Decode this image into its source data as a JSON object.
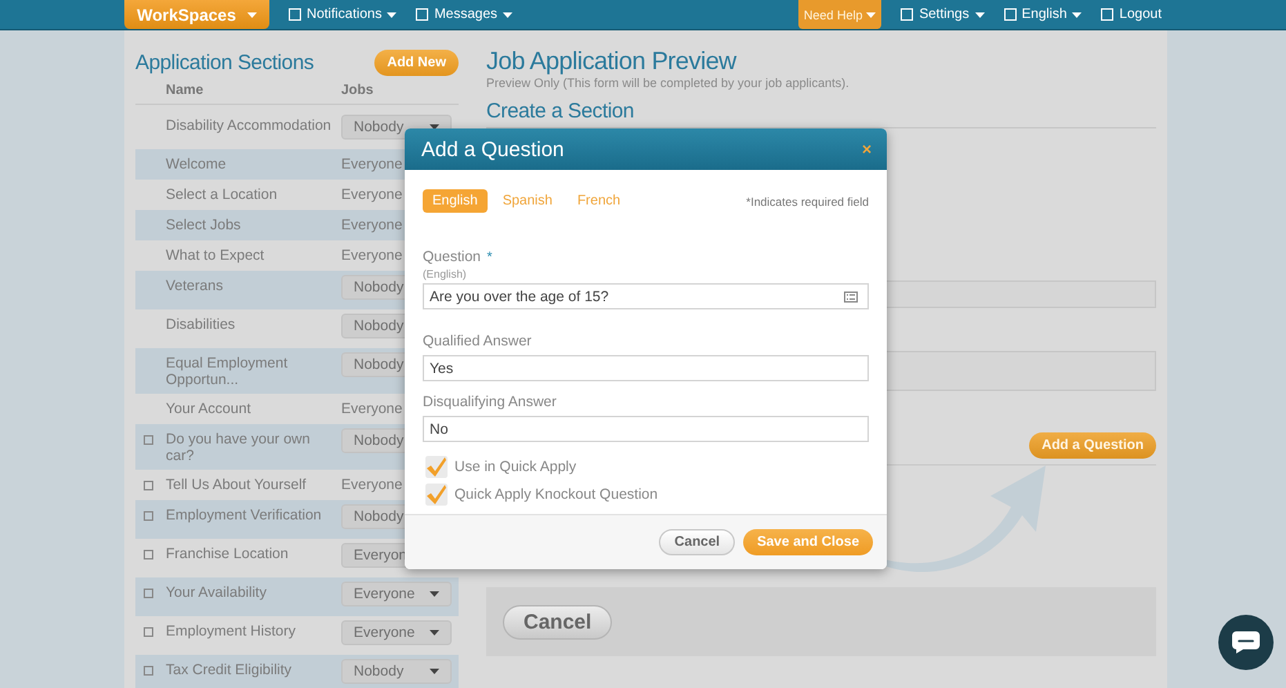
{
  "nav": {
    "brand": "WorkSpaces",
    "left": [
      {
        "label": "Notifications"
      },
      {
        "label": "Messages"
      }
    ],
    "help": "Need Help",
    "right": [
      {
        "label": "Settings",
        "caret": true
      },
      {
        "label": "English",
        "caret": true
      },
      {
        "label": "Logout",
        "caret": false
      }
    ]
  },
  "sidebar": {
    "title": "Application Sections",
    "add_button": "Add New",
    "columns": [
      "Name",
      "Jobs"
    ],
    "rows": [
      {
        "name": "Disability Accommodation",
        "jobs": "Nobody",
        "kind": "select"
      },
      {
        "name": "Welcome",
        "jobs": "Everyone",
        "kind": "text"
      },
      {
        "name": "Select a Location",
        "jobs": "Everyone",
        "kind": "text"
      },
      {
        "name": "Select Jobs",
        "jobs": "Everyone",
        "kind": "text"
      },
      {
        "name": "What to Expect",
        "jobs": "Everyone",
        "kind": "text"
      },
      {
        "name": "Veterans",
        "jobs": "Nobody",
        "kind": "select"
      },
      {
        "name": "Disabilities",
        "jobs": "Nobody",
        "kind": "select"
      },
      {
        "name": "Equal Employment Opportun...",
        "jobs": "Nobody",
        "kind": "select"
      },
      {
        "name": "Your Account",
        "jobs": "Everyone",
        "kind": "text"
      },
      {
        "name": "Do you have your own car?",
        "jobs": "Nobody",
        "kind": "select",
        "checkbox": {
          "checked": false
        }
      },
      {
        "name": "Tell Us About Yourself",
        "jobs": "Everyone",
        "kind": "text",
        "checkbox": {
          "checked": false
        }
      },
      {
        "name": "Employment Verification",
        "jobs": "Nobody",
        "kind": "select",
        "checkbox": {
          "checked": false
        }
      },
      {
        "name": "Franchise Location",
        "jobs": "Everyon",
        "kind": "select",
        "checkbox": {
          "checked": false
        }
      },
      {
        "name": "Your Availability",
        "jobs": "Everyone",
        "kind": "select",
        "checkbox": {
          "checked": false
        }
      },
      {
        "name": "Employment History",
        "jobs": "Everyone",
        "kind": "select",
        "checkbox": {
          "checked": false
        }
      },
      {
        "name": "Tax Credit Eligibility",
        "jobs": "Nobody",
        "kind": "select",
        "checkbox": {
          "checked": false
        }
      }
    ]
  },
  "preview": {
    "title": "Job Application Preview",
    "subtitle": "Preview Only (This form will be completed by your job applicants).",
    "section_heading": "Create a Section",
    "add_question_button": "Add a Question",
    "cancel_button": "Cancel"
  },
  "dialog": {
    "title": "Add a Question",
    "close": "×",
    "tabs": [
      {
        "label": "English",
        "selected": true
      },
      {
        "label": "Spanish",
        "selected": false
      },
      {
        "label": "French",
        "selected": false
      }
    ],
    "required_note": "*Indicates required field",
    "question_label": "Question",
    "required_mark": "*",
    "question_sublabel": "(English)",
    "question_value": "Are you over the age of 15?",
    "qualified_label": "Qualified Answer",
    "qualified_value": "Yes",
    "disqualifying_label": "Disqualifying Answer",
    "disqualifying_value": "No",
    "options": [
      {
        "label": "Use in Quick Apply",
        "checked": true
      },
      {
        "label": "Quick Apply Knockout Question",
        "checked": true
      }
    ],
    "cancel": "Cancel",
    "save": "Save and Close"
  }
}
